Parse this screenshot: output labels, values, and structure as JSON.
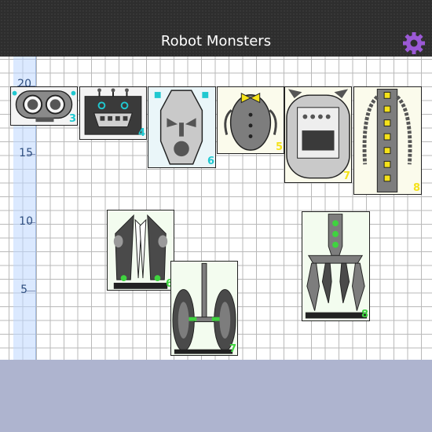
{
  "app": {
    "title": "Robot Monsters",
    "settings_icon": "gear-icon",
    "accent_color": "#9b59d6"
  },
  "axis": {
    "labels": [
      "20",
      "15",
      "10",
      "5"
    ]
  },
  "pieces": [
    {
      "name": "head-goggles",
      "number": "3",
      "badge_color": "cyan"
    },
    {
      "name": "head-grille",
      "number": "4",
      "badge_color": "cyan"
    },
    {
      "name": "head-mask",
      "number": "6",
      "badge_color": "cyan"
    },
    {
      "name": "body-bowtie",
      "number": "5",
      "badge_color": "yellow"
    },
    {
      "name": "body-oven",
      "number": "7",
      "badge_color": "yellow"
    },
    {
      "name": "body-tall",
      "number": "8",
      "badge_color": "yellow"
    },
    {
      "name": "legs-angled",
      "number": "6",
      "badge_color": "green"
    },
    {
      "name": "legs-wheels",
      "number": "7",
      "badge_color": "green"
    },
    {
      "name": "legs-claw",
      "number": "8",
      "badge_color": "green"
    }
  ]
}
